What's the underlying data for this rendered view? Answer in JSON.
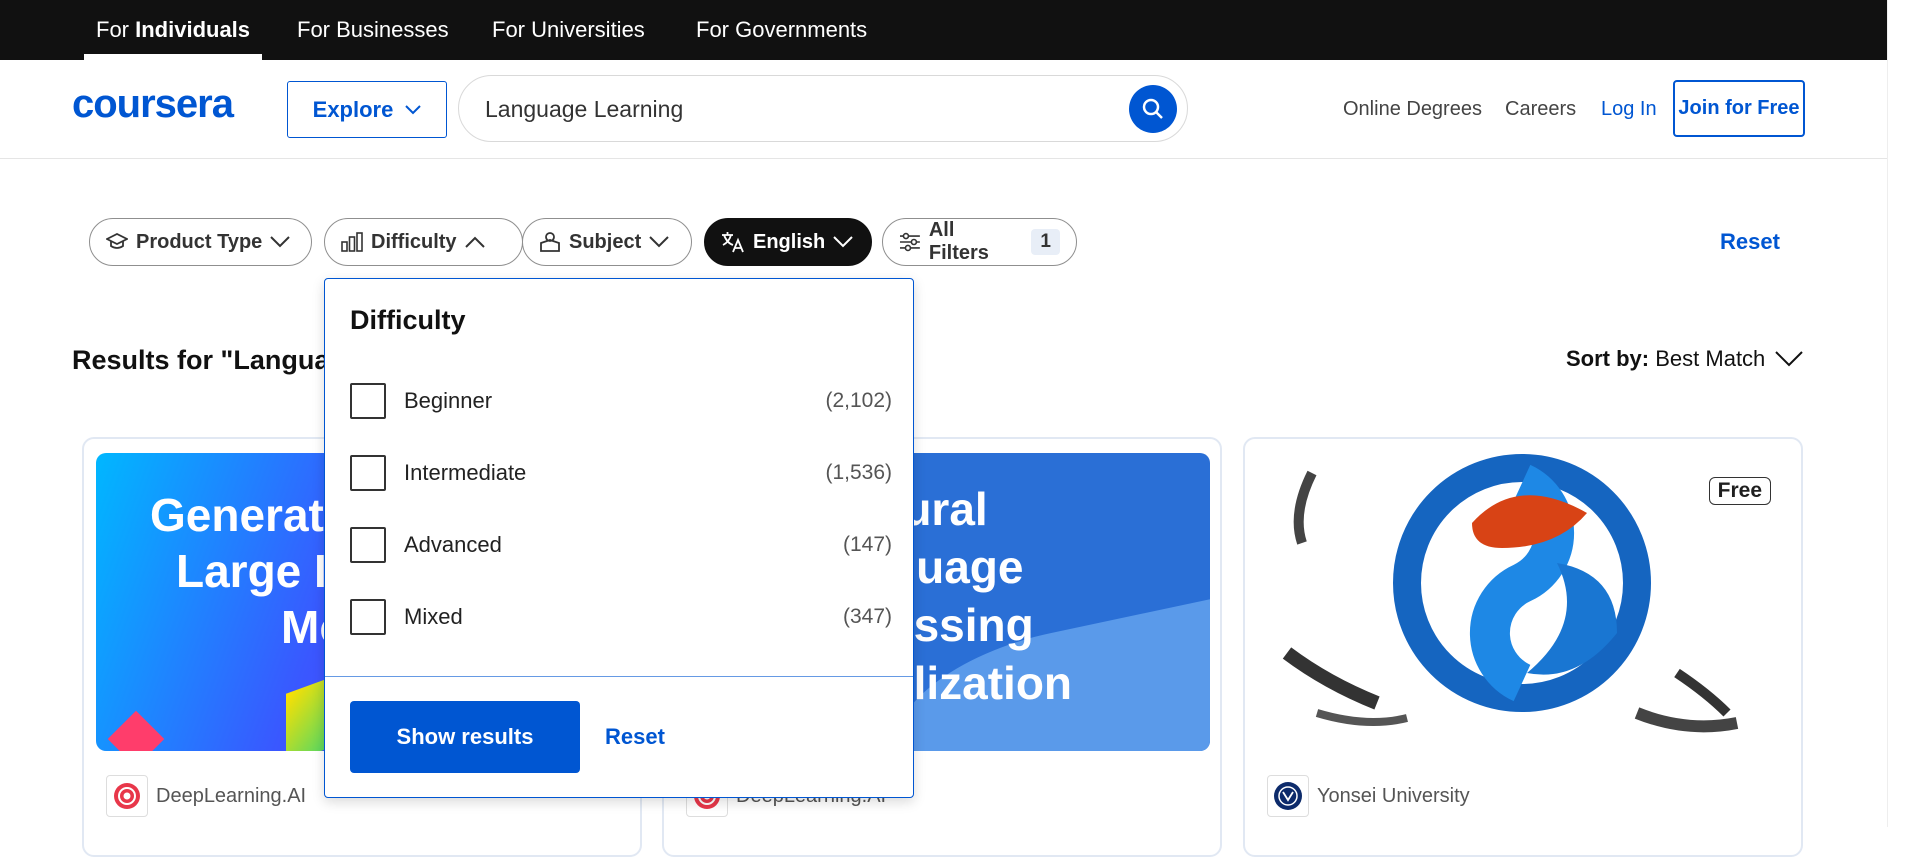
{
  "audience_tabs": [
    {
      "label_prefix": "For ",
      "label_bold": "Individuals"
    },
    {
      "label": "For Businesses"
    },
    {
      "label": "For Universities"
    },
    {
      "label": "For Governments"
    }
  ],
  "header": {
    "logo": "coursera",
    "explore_label": "Explore",
    "search_value": "Language Learning",
    "links": [
      "Online Degrees",
      "Careers",
      "Log In"
    ],
    "join_label": "Join for Free"
  },
  "filters": {
    "chips": [
      "Product Type",
      "Difficulty",
      "Subject",
      "English",
      "All Filters"
    ],
    "all_filters_count": "1",
    "reset_label": "Reset"
  },
  "results": {
    "title_prefix": "Results for \"Langua",
    "sort_label": "Sort by:",
    "sort_value": "Best Match"
  },
  "dropdown": {
    "title": "Difficulty",
    "options": [
      {
        "label": "Beginner",
        "count": "(2,102)"
      },
      {
        "label": "Intermediate",
        "count": "(1,536)"
      },
      {
        "label": "Advanced",
        "count": "(147)"
      },
      {
        "label": "Mixed",
        "count": "(347)"
      }
    ],
    "show_results_label": "Show results",
    "reset_label": "Reset"
  },
  "cards": [
    {
      "thumb_lines": [
        "Generat",
        "Large I",
        "Mo"
      ],
      "partner": "DeepLearning.AI"
    },
    {
      "thumb_lines": [
        "tural",
        "guage",
        "essing",
        "alization"
      ],
      "partner": "DeepLearning.AI"
    },
    {
      "badge": "Free",
      "partner": "Yonsei University"
    }
  ],
  "colors": {
    "brand": "#0056d2",
    "topbar": "#111111"
  }
}
